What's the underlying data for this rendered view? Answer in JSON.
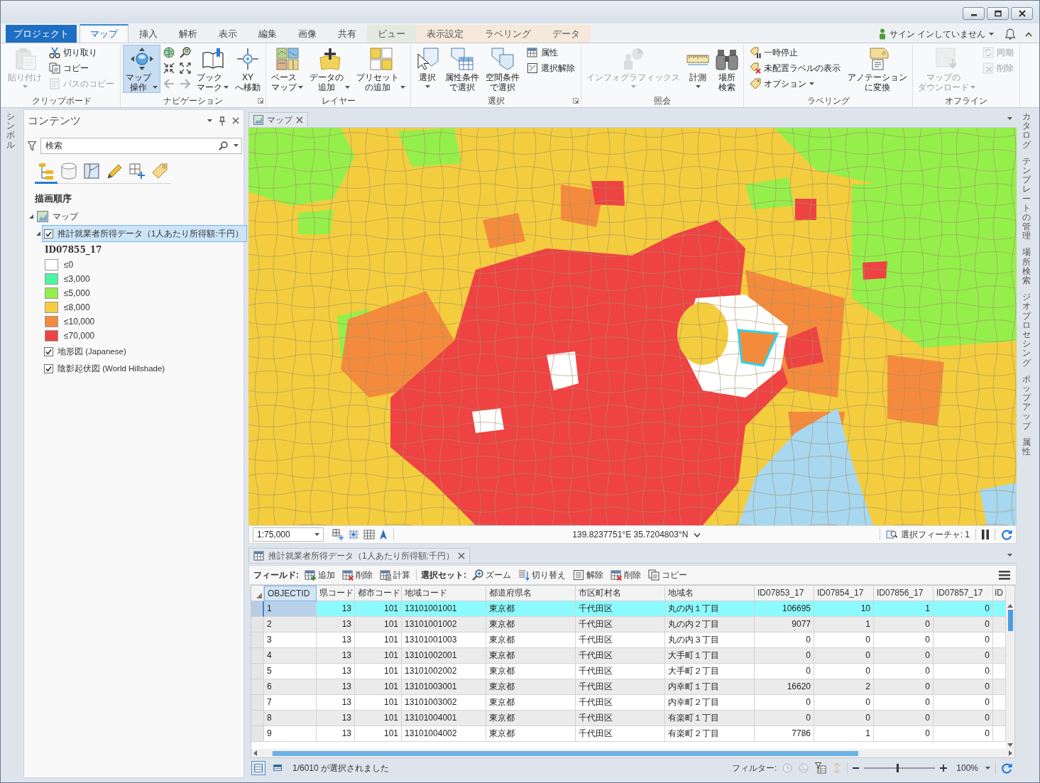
{
  "tabs": [
    {
      "label": "プロジェクト",
      "kind": "file",
      "selected": false
    },
    {
      "label": "マップ",
      "kind": "core",
      "selected": true
    },
    {
      "label": "挿入",
      "kind": "core",
      "selected": false
    },
    {
      "label": "解析",
      "kind": "core",
      "selected": false
    },
    {
      "label": "表示",
      "kind": "core",
      "selected": false
    },
    {
      "label": "編集",
      "kind": "core",
      "selected": false
    },
    {
      "label": "画像",
      "kind": "core",
      "selected": false
    },
    {
      "label": "共有",
      "kind": "core",
      "selected": false
    },
    {
      "label": "ビュー",
      "kind": "contextual",
      "color": "#e3eadf",
      "selected": false
    },
    {
      "label": "表示設定",
      "kind": "contextual",
      "color": "#f6e9dc",
      "selected": false
    },
    {
      "label": "ラベリング",
      "kind": "contextual",
      "color": "#f6e9dc",
      "selected": false
    },
    {
      "label": "データ",
      "kind": "contextual",
      "color": "#f6e9dc",
      "selected": false
    }
  ],
  "account": {
    "label": "サイン インしていません"
  },
  "ribbon": {
    "groups": [
      {
        "title": "クリップボード",
        "launcher": false,
        "buttons": [
          {
            "kind": "large",
            "label": "貼り付け",
            "disabled": true,
            "dropdown": true,
            "pressed": false
          },
          {
            "kind": "small",
            "label": "切り取り",
            "disabled": false,
            "dropdown": false,
            "pressed": false
          },
          {
            "kind": "small",
            "label": "コピー",
            "disabled": false,
            "dropdown": false,
            "pressed": false
          },
          {
            "kind": "small",
            "label": "パスのコピー",
            "disabled": true,
            "dropdown": false,
            "pressed": false
          }
        ]
      },
      {
        "title": "ナビゲーション",
        "launcher": true,
        "buttons": [
          {
            "kind": "large",
            "label": "マップ操作",
            "disabled": false,
            "dropdown": true,
            "pressed": true
          },
          {
            "kind": "icon",
            "disabled": false,
            "pressed": false
          },
          {
            "kind": "icon",
            "disabled": false,
            "pressed": false
          },
          {
            "kind": "icon",
            "disabled": true,
            "pressed": false
          },
          {
            "kind": "icon",
            "disabled": false,
            "pressed": false
          },
          {
            "kind": "icon",
            "disabled": false,
            "pressed": false
          },
          {
            "kind": "icon",
            "disabled": true,
            "pressed": false
          },
          {
            "kind": "large",
            "label": "ブックマーク",
            "disabled": false,
            "dropdown": true,
            "pressed": false
          },
          {
            "kind": "large",
            "label": "XYへ移動",
            "disabled": false,
            "dropdown": false,
            "pressed": false
          }
        ]
      },
      {
        "title": "レイヤー",
        "launcher": false,
        "buttons": [
          {
            "kind": "large",
            "label": "ベースマップ",
            "disabled": false,
            "dropdown": true,
            "pressed": false
          },
          {
            "kind": "large",
            "label": "データの追加",
            "disabled": false,
            "dropdown": true,
            "pressed": false
          },
          {
            "kind": "large",
            "label": "プリセットの追加",
            "disabled": false,
            "dropdown": true,
            "pressed": false
          }
        ]
      },
      {
        "title": "選択",
        "launcher": true,
        "buttons": [
          {
            "kind": "large",
            "label": "選択",
            "disabled": false,
            "dropdown": true,
            "pressed": false
          },
          {
            "kind": "large",
            "label": "属性条件で選択",
            "disabled": false,
            "dropdown": false,
            "pressed": false
          },
          {
            "kind": "large",
            "label": "空間条件で選択",
            "disabled": false,
            "dropdown": false,
            "pressed": false
          },
          {
            "kind": "small",
            "label": "属性",
            "disabled": false,
            "dropdown": false,
            "pressed": false
          },
          {
            "kind": "small",
            "label": "選択解除",
            "disabled": false,
            "dropdown": false,
            "pressed": false
          }
        ]
      },
      {
        "title": "照会",
        "launcher": false,
        "buttons": [
          {
            "kind": "large",
            "label": "インフォグラフィックス",
            "disabled": true,
            "dropdown": true,
            "pressed": false
          },
          {
            "kind": "large",
            "label": "計測",
            "disabled": false,
            "dropdown": true,
            "pressed": false
          },
          {
            "kind": "large",
            "label": "場所検索",
            "disabled": false,
            "dropdown": false,
            "pressed": false
          }
        ]
      },
      {
        "title": "ラベリング",
        "launcher": false,
        "buttons": [
          {
            "kind": "small",
            "label": "一時停止",
            "disabled": false,
            "dropdown": false,
            "pressed": false
          },
          {
            "kind": "small",
            "label": "未配置ラベルの表示",
            "disabled": false,
            "dropdown": false,
            "pressed": false
          },
          {
            "kind": "small",
            "label": "オプション",
            "disabled": false,
            "dropdown": true,
            "pressed": false
          },
          {
            "kind": "large",
            "label": "アノテーションに変換",
            "disabled": false,
            "dropdown": false,
            "pressed": false
          }
        ]
      },
      {
        "title": "オフライン",
        "launcher": false,
        "buttons": [
          {
            "kind": "large",
            "label": "マップのダウンロード",
            "disabled": true,
            "dropdown": true,
            "pressed": false
          },
          {
            "kind": "small",
            "label": "同期",
            "disabled": true,
            "dropdown": false,
            "pressed": false
          },
          {
            "kind": "small",
            "label": "削除",
            "disabled": true,
            "dropdown": false,
            "pressed": false
          }
        ]
      }
    ]
  },
  "side_panes": {
    "left": [
      "シンボル"
    ],
    "right": [
      "カタログ",
      "テンプレートの管理",
      "場所検索",
      "ジオプロセシング",
      "ポップアップ",
      "属性"
    ]
  },
  "contents": {
    "title": "コンテンツ",
    "search": {
      "placeholder": "検索"
    },
    "view_tabs": [
      {
        "selected": true
      },
      {
        "selected": false
      },
      {
        "selected": false
      },
      {
        "selected": false
      },
      {
        "selected": false
      },
      {
        "selected": false
      }
    ],
    "section": "描画順序",
    "tree": [
      {
        "kind": "map",
        "label": "マップ",
        "expanded": true,
        "selected": false,
        "children": [
          {
            "kind": "layer",
            "label": "推計就業者所得データ（1人あたり所得額:千円）",
            "checked": true,
            "expanded": true,
            "selected": true,
            "legend": {
              "field": "ID07855_17",
              "classes": [
                {
                  "label": "≤0",
                  "color": "#ffffff"
                },
                {
                  "label": "≤3,000",
                  "color": "#4ef3a4"
                },
                {
                  "label": "≤5,000",
                  "color": "#95ef4b"
                },
                {
                  "label": "≤8,000",
                  "color": "#f4cd3e"
                },
                {
                  "label": "≤10,000",
                  "color": "#f48b3c"
                },
                {
                  "label": "≤70,000",
                  "color": "#ef4242"
                }
              ]
            }
          },
          {
            "kind": "layer",
            "label": "地形図 (Japanese)",
            "checked": true,
            "selected": false
          },
          {
            "kind": "layer",
            "label": "陰影起伏図 (World Hillshade)",
            "checked": true,
            "selected": false
          }
        ]
      }
    ]
  },
  "map_view": {
    "tab": "マップ",
    "scale": "1:75,000",
    "coordinates": "139.8237751°E 35.7204803°N",
    "selected_features": "選択フィーチャ: 1"
  },
  "attribute_table": {
    "tab": "推計就業者所得データ（1人あたり所得額:千円）",
    "toolbar": [
      {
        "label": "フィールド:",
        "buttons": [
          "追加",
          "削除",
          "計算"
        ]
      },
      {
        "label": "選択セット:",
        "buttons": [
          "ズーム",
          "切り替え",
          "解除",
          "削除",
          "コピー"
        ]
      }
    ],
    "columns": [
      {
        "label": "OBJECTID",
        "kind": "oid",
        "selected": true
      },
      {
        "label": "県コード",
        "kind": "number",
        "selected": false
      },
      {
        "label": "都市コード",
        "kind": "number",
        "selected": false
      },
      {
        "label": "地域コード",
        "kind": "text",
        "selected": false
      },
      {
        "label": "都道府県名",
        "kind": "text",
        "selected": false
      },
      {
        "label": "市区町村名",
        "kind": "text",
        "selected": false
      },
      {
        "label": "地域名",
        "kind": "text",
        "selected": false
      },
      {
        "label": "ID07853_17",
        "kind": "number",
        "selected": false
      },
      {
        "label": "ID07854_17",
        "kind": "number",
        "selected": false
      },
      {
        "label": "ID07856_17",
        "kind": "number",
        "selected": false
      },
      {
        "label": "ID07857_17",
        "kind": "number",
        "selected": false
      },
      {
        "label": "ID",
        "kind": "number",
        "selected": false
      }
    ],
    "rows": [
      {
        "selected": true,
        "cells": [
          "1",
          "13",
          "101",
          "13101001001",
          "東京都",
          "千代田区",
          "丸の内１丁目",
          "106695",
          "10",
          "1",
          "0"
        ]
      },
      {
        "selected": false,
        "cells": [
          "2",
          "13",
          "101",
          "13101001002",
          "東京都",
          "千代田区",
          "丸の内２丁目",
          "9077",
          "1",
          "0",
          "0"
        ]
      },
      {
        "selected": false,
        "cells": [
          "3",
          "13",
          "101",
          "13101001003",
          "東京都",
          "千代田区",
          "丸の内３丁目",
          "0",
          "0",
          "0",
          "0"
        ]
      },
      {
        "selected": false,
        "cells": [
          "4",
          "13",
          "101",
          "13101002001",
          "東京都",
          "千代田区",
          "大手町１丁目",
          "0",
          "0",
          "0",
          "0"
        ]
      },
      {
        "selected": false,
        "cells": [
          "5",
          "13",
          "101",
          "13101002002",
          "東京都",
          "千代田区",
          "大手町２丁目",
          "0",
          "0",
          "0",
          "0"
        ]
      },
      {
        "selected": false,
        "cells": [
          "6",
          "13",
          "101",
          "13101003001",
          "東京都",
          "千代田区",
          "内幸町１丁目",
          "16620",
          "2",
          "0",
          "0"
        ]
      },
      {
        "selected": false,
        "cells": [
          "7",
          "13",
          "101",
          "13101003002",
          "東京都",
          "千代田区",
          "内幸町２丁目",
          "0",
          "0",
          "0",
          "0"
        ]
      },
      {
        "selected": false,
        "cells": [
          "8",
          "13",
          "101",
          "13101004001",
          "東京都",
          "千代田区",
          "有楽町１丁目",
          "0",
          "0",
          "0",
          "0"
        ]
      },
      {
        "selected": false,
        "cells": [
          "9",
          "13",
          "101",
          "13101004002",
          "東京都",
          "千代田区",
          "有楽町２丁目",
          "7786",
          "1",
          "0",
          "0"
        ]
      }
    ],
    "views": [
      {
        "selected": true
      },
      {
        "selected": false
      }
    ],
    "status": "1/6010 が選択されました",
    "filter_label": "フィルター:",
    "filters": [
      {
        "disabled": true
      },
      {
        "disabled": true
      },
      {
        "disabled": false
      },
      {
        "disabled": true
      }
    ],
    "zoom": {
      "level": 0.48,
      "reading": "100%"
    }
  }
}
